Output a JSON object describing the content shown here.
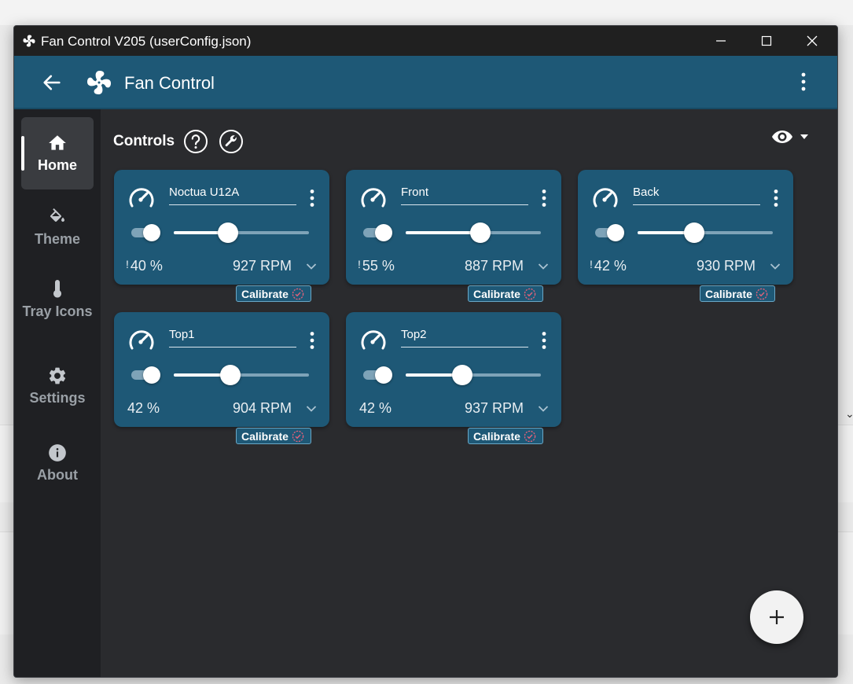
{
  "window": {
    "title": "Fan Control V205 (userConfig.json)"
  },
  "appbar": {
    "title": "Fan Control"
  },
  "sidebar": {
    "items": [
      {
        "label": "Home",
        "icon": "home-icon",
        "active": true
      },
      {
        "label": "Theme",
        "icon": "paint-bucket-icon",
        "active": false
      },
      {
        "label": "Tray Icons",
        "icon": "thermometer-icon",
        "active": false
      },
      {
        "label": "Settings",
        "icon": "gear-icon",
        "active": false
      },
      {
        "label": "About",
        "icon": "info-icon",
        "active": false
      }
    ]
  },
  "content": {
    "title": "Controls"
  },
  "cards": [
    {
      "name": "Noctua U12A",
      "percent": "40 %",
      "rpm": "927 RPM",
      "warning": "!",
      "slider_value": 0.4,
      "calibrate": "Calibrate"
    },
    {
      "name": "Front",
      "percent": "55 %",
      "rpm": "887 RPM",
      "warning": "!",
      "slider_value": 0.55,
      "calibrate": "Calibrate"
    },
    {
      "name": "Back",
      "percent": "42 %",
      "rpm": "930 RPM",
      "warning": "!",
      "slider_value": 0.42,
      "calibrate": "Calibrate"
    },
    {
      "name": "Top1",
      "percent": "42 %",
      "rpm": "904 RPM",
      "warning": "",
      "slider_value": 0.42,
      "calibrate": "Calibrate"
    },
    {
      "name": "Top2",
      "percent": "42 %",
      "rpm": "937 RPM",
      "warning": "",
      "slider_value": 0.42,
      "calibrate": "Calibrate"
    }
  ],
  "colors": {
    "accent": "#1e5876",
    "surface": "#2a2b2e",
    "calibrate_check": "#e2627a"
  }
}
